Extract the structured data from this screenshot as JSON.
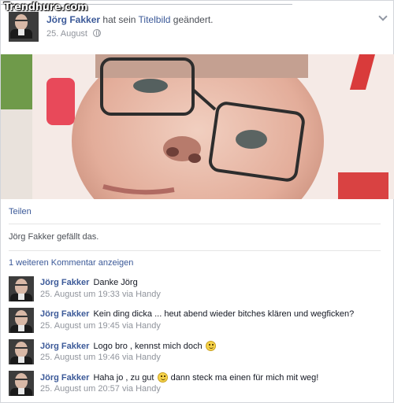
{
  "watermark": "Trendhure.com",
  "post": {
    "author": "Jörg Fakker",
    "action_prefix": "hat sein",
    "action_item": "Titelbild",
    "action_suffix": "geändert.",
    "date": "25. August",
    "privacy_icon": "globe-icon",
    "menu_icon": "chevron-down-icon"
  },
  "actions": {
    "share": "Teilen"
  },
  "likes": {
    "name": "Jörg Fakker",
    "text": "gefällt das."
  },
  "more_comments": "1 weiteren Kommentar anzeigen",
  "comments": [
    {
      "author": "Jörg Fakker",
      "text": "Danke Jörg",
      "meta": "25. August um 19:33 via Handy"
    },
    {
      "author": "Jörg Fakker",
      "text": "Kein ding dicka ... heut abend wieder bitches klären und wegficken?",
      "meta": "25. August um 19:45 via Handy"
    },
    {
      "author": "Jörg Fakker",
      "text": "Logo bro , kennst mich doch",
      "meta": "25. August um 19:46 via Handy"
    },
    {
      "author": "Jörg Fakker",
      "text_a": "Haha jo , zu gut",
      "text_b": "dann steck ma einen für mich mit weg!",
      "meta": "25. August um 20:57 via Handy"
    }
  ],
  "colors": {
    "link": "#3b5998",
    "muted": "#90949c",
    "text": "#141823"
  }
}
